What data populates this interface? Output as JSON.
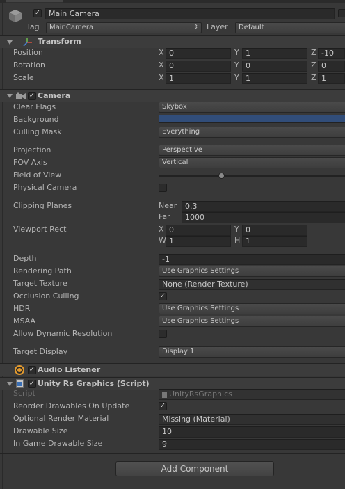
{
  "object": {
    "name": "Main Camera",
    "tag_label": "Tag",
    "tag_value": "MainCamera",
    "layer_label": "Layer",
    "layer_value": "Default",
    "active": true
  },
  "transform": {
    "title": "Transform",
    "rows": [
      {
        "label": "Position",
        "x": "0",
        "y": "1",
        "z": "-10"
      },
      {
        "label": "Rotation",
        "x": "0",
        "y": "0",
        "z": "0"
      },
      {
        "label": "Scale",
        "x": "1",
        "y": "1",
        "z": "1"
      }
    ],
    "axis_x": "X",
    "axis_y": "Y",
    "axis_z": "Z"
  },
  "camera": {
    "title": "Camera",
    "clear_flags": {
      "label": "Clear Flags",
      "value": "Skybox"
    },
    "background": {
      "label": "Background",
      "color": "#314d79"
    },
    "culling_mask": {
      "label": "Culling Mask",
      "value": "Everything"
    },
    "projection": {
      "label": "Projection",
      "value": "Perspective"
    },
    "fov_axis": {
      "label": "FOV Axis",
      "value": "Vertical"
    },
    "field_of_view": {
      "label": "Field of View"
    },
    "physical_camera": {
      "label": "Physical Camera"
    },
    "clipping": {
      "label": "Clipping Planes",
      "near_label": "Near",
      "near": "0.3",
      "far_label": "Far",
      "far": "1000"
    },
    "viewport": {
      "label": "Viewport Rect",
      "x": "0",
      "y": "0",
      "w": "1",
      "h": "1",
      "x_label": "X",
      "y_label": "Y",
      "w_label": "W",
      "h_label": "H"
    },
    "depth": {
      "label": "Depth",
      "value": "-1"
    },
    "rendering_path": {
      "label": "Rendering Path",
      "value": "Use Graphics Settings"
    },
    "target_texture": {
      "label": "Target Texture",
      "value": "None (Render Texture)"
    },
    "occlusion_culling": {
      "label": "Occlusion Culling"
    },
    "hdr": {
      "label": "HDR",
      "value": "Use Graphics Settings"
    },
    "msaa": {
      "label": "MSAA",
      "value": "Use Graphics Settings"
    },
    "dynamic_resolution": {
      "label": "Allow Dynamic Resolution"
    },
    "target_display": {
      "label": "Target Display",
      "value": "Display 1"
    }
  },
  "audio_listener": {
    "title": "Audio Listener"
  },
  "script_component": {
    "title": "Unity Rs Graphics (Script)",
    "script": {
      "label": "Script",
      "value": "UnityRsGraphics"
    },
    "reorder": {
      "label": "Reorder Drawables On Update"
    },
    "material": {
      "label": "Optional Render Material",
      "value": "Missing (Material)"
    },
    "drawable_size": {
      "label": "Drawable Size",
      "value": "10"
    },
    "ingame_size": {
      "label": "In Game Drawable Size",
      "value": "9"
    }
  },
  "add_component": {
    "label": "Add Component"
  },
  "colors": {
    "accent": "#314d79",
    "panel": "#383838",
    "field": "#2a2a2a"
  }
}
